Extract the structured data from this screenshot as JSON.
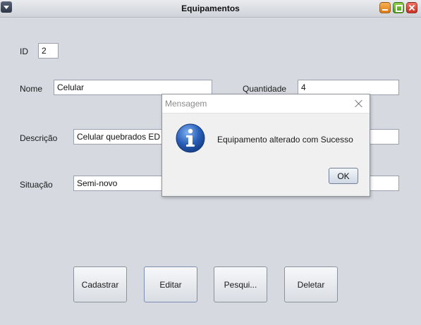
{
  "window": {
    "title": "Equipamentos"
  },
  "form": {
    "id_label": "ID",
    "id_value": "2",
    "nome_label": "Nome",
    "nome_value": "Celular",
    "quantidade_label": "Quantidade",
    "quantidade_value": "4",
    "descricao_label": "Descrição",
    "descricao_value": "Celular quebrados ED",
    "situacao_label": "Situação",
    "situacao_value": "Semi-novo"
  },
  "buttons": {
    "cadastrar": "Cadastrar",
    "editar": "Editar",
    "pesquisar": "Pesqui...",
    "deletar": "Deletar"
  },
  "dialog": {
    "title": "Mensagem",
    "message": "Equipamento alterado com Sucesso",
    "ok_label": "OK",
    "icon": "info-icon"
  },
  "colors": {
    "background": "#d6d9df",
    "info_icon": "#2a5fb8",
    "close_button": "#c9301f",
    "minimize_button": "#e07a12",
    "maximize_button": "#4c9a1f"
  }
}
